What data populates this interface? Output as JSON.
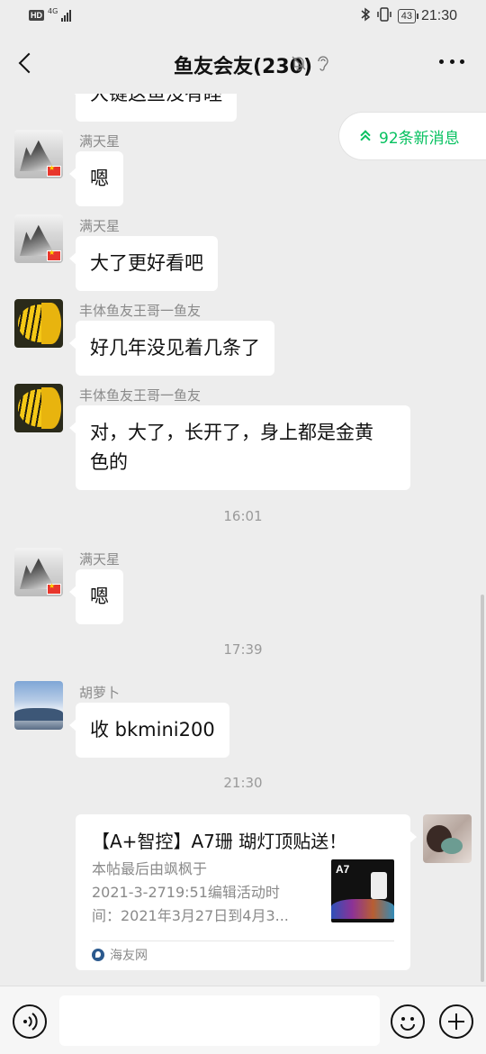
{
  "status_bar": {
    "hd_label": "HD",
    "network_label": "4G",
    "battery_level": "43",
    "time": "21:30",
    "icons": [
      "bluetooth-icon",
      "vibrate-icon",
      "battery-icon",
      "signal-icon"
    ]
  },
  "nav": {
    "title": "鱼友会友(230)",
    "icons": [
      "back-icon",
      "mute-bell-icon",
      "ear-icon",
      "more-icon"
    ]
  },
  "chat": {
    "partial_top_text": "大键这鱼没有睦",
    "new_messages_label": "92条新消息",
    "messages": [
      {
        "sender": "满天星",
        "text": "嗯",
        "avatar": "ink-landscape-avatar"
      },
      {
        "sender": "满天星",
        "text": "大了更好看吧",
        "avatar": "ink-landscape-avatar"
      },
      {
        "sender": "丰体鱼友王哥一鱼友",
        "text": "好几年没见着几条了",
        "avatar": "butterflyfish-avatar"
      },
      {
        "sender": "丰体鱼友王哥一鱼友",
        "text_line1": "对，大了，长开了，身上都是金黄",
        "text_line2": "色的",
        "avatar": "butterflyfish-avatar"
      },
      {
        "sender": "满天星",
        "text": "嗯",
        "avatar": "ink-landscape-avatar"
      },
      {
        "sender": "胡萝卜",
        "text": "收 bkmini200",
        "avatar": "snow-lake-avatar"
      }
    ],
    "timestamps": [
      "16:01",
      "17:39",
      "21:30"
    ],
    "link_card": {
      "title": "【A+智控】A7珊 瑚灯顶贴送！",
      "desc_line1": "本帖最后由飒枫于",
      "desc_line2": "2021-3-2719:51编辑活动时",
      "desc_line3": "间：2021年3月27日到4月3...",
      "thumb_label": "A7",
      "source": "海友网"
    }
  },
  "input_bar": {
    "placeholder": "",
    "icons": [
      "voice-icon",
      "emoji-icon",
      "plus-icon"
    ]
  },
  "colors": {
    "accent_green": "#07c160",
    "background": "#ededed",
    "bubble": "#ffffff"
  }
}
